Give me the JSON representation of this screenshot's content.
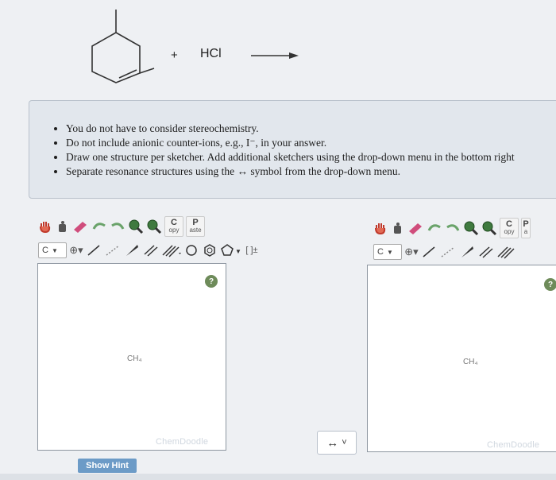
{
  "reaction": {
    "plus": "+",
    "reagent": "HCl"
  },
  "instructions": {
    "items": [
      "You do not have to consider stereochemistry.",
      "Do not include anionic counter-ions, e.g., I⁻, in your answer.",
      "Draw one structure per sketcher. Add additional sketchers using the drop-down menu in the bottom right",
      "Separate resonance structures using the ↔ symbol from the drop-down menu."
    ]
  },
  "sketcher_left": {
    "copy_label_top": "C",
    "copy_label_bottom": "opy",
    "paste_label_top": "P",
    "paste_label_bottom": "aste",
    "element": "C",
    "bracket_label": "[ ]±",
    "canvas_label": "CH₄",
    "watermark": "ChemDoodle",
    "help": "?"
  },
  "sketcher_right": {
    "copy_label_top": "C",
    "copy_label_bottom": "opy",
    "paste_label_top": "P",
    "paste_label_bottom": "a",
    "element": "C",
    "canvas_label": "CH₄",
    "watermark": "ChemDoodle",
    "help": "?"
  },
  "arrow_picker": {
    "symbol": "↔",
    "caret": "˅"
  },
  "show_hint": "Show Hint",
  "colors": {
    "accent_button": "#6c9bc7",
    "help_icon": "#6e8b5a",
    "panel_bg": "#e2e7ed"
  }
}
